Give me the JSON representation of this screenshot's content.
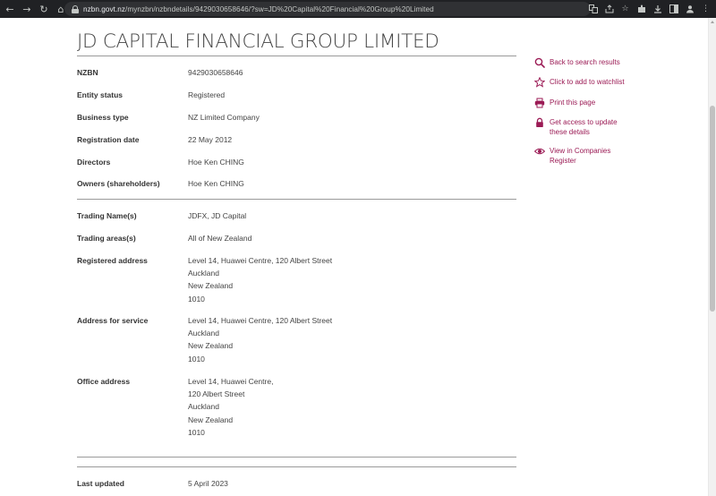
{
  "browser": {
    "url_host": "nzbn.govt.nz",
    "url_path": "/mynzbn/nzbndetails/9429030658646/?sw=JD%20Capital%20Financial%20Group%20Limited"
  },
  "page": {
    "title": "JD CAPITAL FINANCIAL GROUP LIMITED"
  },
  "section1": [
    {
      "label": "NZBN",
      "value": "9429030658646"
    },
    {
      "label": "Entity status",
      "value": "Registered"
    },
    {
      "label": "Business type",
      "value": "NZ Limited Company"
    },
    {
      "label": "Registration date",
      "value": "22 May 2012"
    },
    {
      "label": "Directors",
      "value": "Hoe Ken CHING"
    },
    {
      "label": "Owners (shareholders)",
      "value": "Hoe Ken CHING"
    }
  ],
  "section2": {
    "trading_names": {
      "label": "Trading Name(s)",
      "value": "JDFX, JD Capital"
    },
    "trading_areas": {
      "label": "Trading areas(s)",
      "value": "All of New Zealand"
    },
    "registered_address": {
      "label": "Registered address",
      "lines": [
        "Level 14, Huawei Centre, 120 Albert Street",
        "Auckland",
        "New Zealand",
        "1010"
      ]
    },
    "address_for_service": {
      "label": "Address for service",
      "lines": [
        "Level 14, Huawei Centre, 120 Albert Street",
        "Auckland",
        "New Zealand",
        "1010"
      ]
    },
    "office_address": {
      "label": "Office address",
      "lines": [
        "Level 14, Huawei Centre,",
        "120 Albert Street",
        "Auckland",
        "New Zealand",
        "1010"
      ]
    }
  },
  "section3": {
    "last_updated": {
      "label": "Last updated",
      "value": "5 April 2023"
    }
  },
  "side_links": {
    "back": "Back to search results",
    "watchlist": "Click to add to watchlist",
    "print": "Print this page",
    "access_line1": "Get access to update",
    "access_line2": "these details",
    "companies_line1": "View in Companies",
    "companies_line2": "Register"
  },
  "colors": {
    "accent": "#9b1b55",
    "chrome": "#202124"
  },
  "icons": {
    "back": "magnifier-icon",
    "watchlist": "star-icon",
    "print": "printer-icon",
    "access": "padlock-icon",
    "companies": "eye-icon"
  }
}
